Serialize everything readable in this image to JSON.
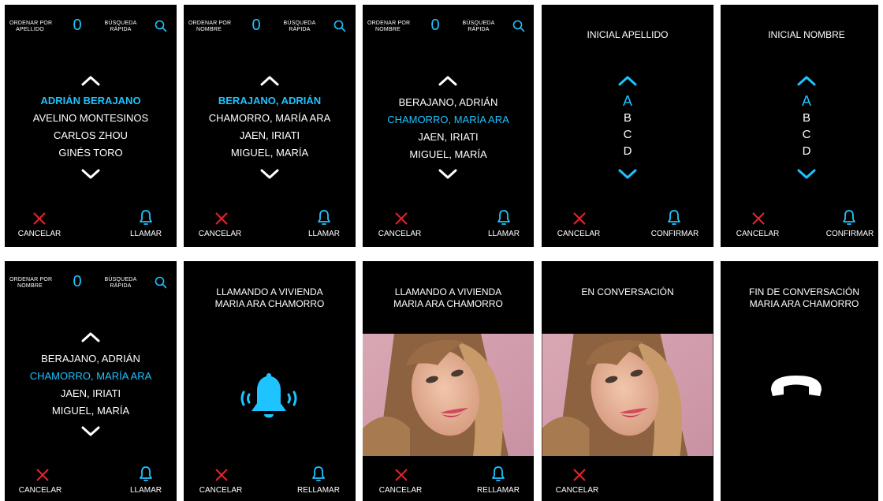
{
  "colors": {
    "accent": "#1ec3ff",
    "cancel": "#e8232a",
    "background": "#000000"
  },
  "common": {
    "sort_by_surname": "ORDENAR POR\nAPELLIDO",
    "sort_by_name": "ORDENAR POR\nNOMBRE",
    "quick_search": "BÚSQUEDA\nRÁPIDA",
    "zero": "0",
    "cancel": "CANCELAR",
    "call": "LLAMAR",
    "confirm": "CONFIRMAR",
    "recall": "RELLAMAR"
  },
  "screens": {
    "s1": {
      "names": [
        "ADRIÁN BERAJANO",
        "AVELINO MONTESINOS",
        "CARLOS ZHOU",
        "GINÉS TORO"
      ]
    },
    "s2": {
      "names": [
        "BERAJANO, ADRIÁN",
        "CHAMORRO, MARÍA ARA",
        "JAEN, IRIATI",
        "MIGUEL, MARÍA"
      ]
    },
    "s3": {
      "names": [
        "BERAJANO, ADRIÁN",
        "CHAMORRO, MARÍA ARA",
        "JAEN, IRIATI",
        "MIGUEL, MARÍA"
      ]
    },
    "s4": {
      "title": "INICIAL APELLIDO",
      "letters": [
        "A",
        "B",
        "C",
        "D"
      ]
    },
    "s5": {
      "title": "INICIAL NOMBRE",
      "letters": [
        "A",
        "B",
        "C",
        "D"
      ]
    },
    "s6": {
      "names": [
        "BERAJANO, ADRIÁN",
        "CHAMORRO, MARÍA ARA",
        "JAEN, IRIATI",
        "MIGUEL, MARÍA"
      ]
    },
    "s7": {
      "title_line1": "LLAMANDO A VIVIENDA",
      "title_line2": "MARIA ARA CHAMORRO"
    },
    "s8": {
      "title_line1": "LLAMANDO A VIVIENDA",
      "title_line2": "MARIA ARA CHAMORRO"
    },
    "s9": {
      "title_line1": "EN CONVERSACIÓN"
    },
    "s10": {
      "title_line1": "FIN DE CONVERSACIÓN",
      "title_line2": "MARIA ARA CHAMORRO"
    }
  }
}
